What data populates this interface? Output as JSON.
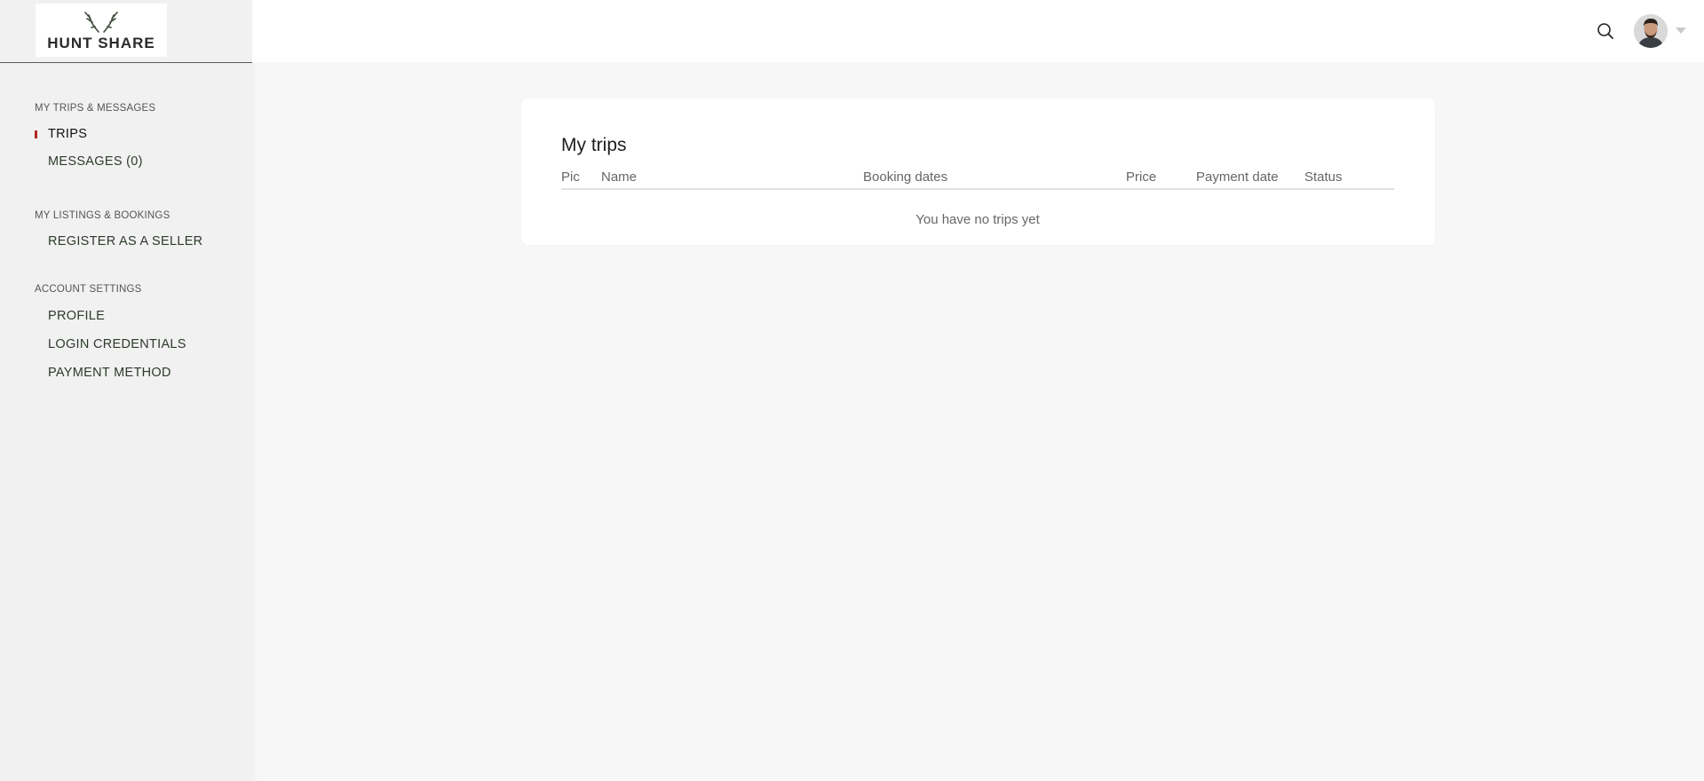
{
  "brand": {
    "logo_text": "HUNT SHARE"
  },
  "sidebar": {
    "sections": [
      {
        "title": "MY TRIPS & MESSAGES",
        "items": [
          {
            "label": "TRIPS",
            "active": true
          },
          {
            "label": "MESSAGES (0)",
            "active": false
          }
        ]
      },
      {
        "title": "MY LISTINGS & BOOKINGS",
        "items": [
          {
            "label": "REGISTER AS A SELLER",
            "active": false
          }
        ]
      },
      {
        "title": "ACCOUNT SETTINGS",
        "items": [
          {
            "label": "PROFILE",
            "active": false
          },
          {
            "label": "LOGIN CREDENTIALS",
            "active": false
          },
          {
            "label": "PAYMENT METHOD",
            "active": false
          }
        ]
      }
    ]
  },
  "header": {
    "search_icon": "search-icon",
    "avatar_icon": "user-avatar",
    "menu_icon": "caret-down-icon"
  },
  "main": {
    "title": "My trips",
    "columns": [
      "Pic",
      "Name",
      "Booking dates",
      "Price",
      "Payment date",
      "Status"
    ],
    "empty_message": "You have no trips yet"
  },
  "colors": {
    "accent": "#b3261e",
    "sidebar_bg": "#f1f1f1",
    "page_bg": "#f7f7f7",
    "card_bg": "#ffffff"
  }
}
